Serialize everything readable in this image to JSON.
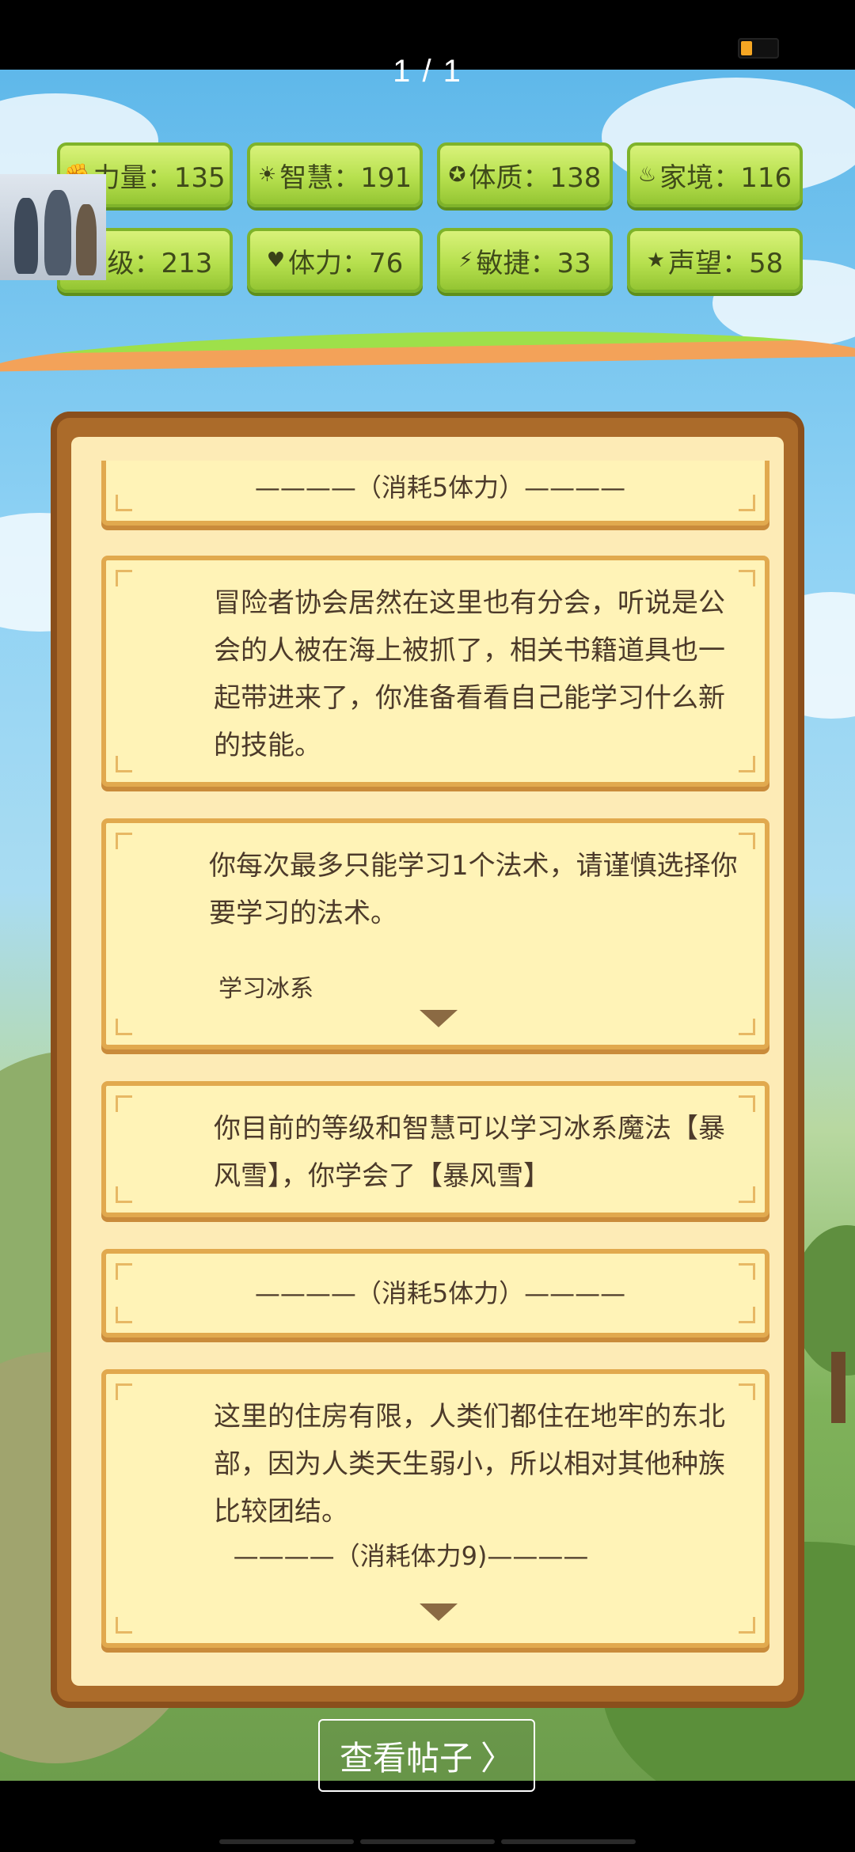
{
  "page_indicator": "1 / 1",
  "stats": [
    {
      "icon": "strength-icon",
      "glyph": "✊",
      "label": "力量：135"
    },
    {
      "icon": "wisdom-icon",
      "glyph": "☀",
      "label": "智慧：191"
    },
    {
      "icon": "constitution-icon",
      "glyph": "✪",
      "label": "体质：138"
    },
    {
      "icon": "family-icon",
      "glyph": "♨",
      "label": "家境：116"
    },
    {
      "icon": "level-icon",
      "glyph": "",
      "label": "等级：213"
    },
    {
      "icon": "stamina-icon",
      "glyph": "♥",
      "label": "体力：76"
    },
    {
      "icon": "agility-icon",
      "glyph": "⚡",
      "label": "敏捷：33"
    },
    {
      "icon": "reputation-icon",
      "glyph": "★",
      "label": "声望：58"
    }
  ],
  "log": {
    "divider_top": "————（消耗5体力）————",
    "event1": "冒险者协会居然在这里也有分会，听说是公会的人被在海上被抓了，相关书籍道具也一起带进来了，你准备看看自己能学习什么新的技能。",
    "event2": "你每次最多只能学习1个法术，请谨慎选择你要学习的法术。",
    "event2_choice": "学习冰系",
    "event3": "你目前的等级和智慧可以学习冰系魔法【暴风雪】，你学会了【暴风雪】",
    "divider_mid": "————（消耗5体力）————",
    "event4": "这里的住房有限，人类们都住在地牢的东北部，因为人类天生弱小，所以相对其他种族比较团结。",
    "event4_cost": "————（消耗体力9)————"
  },
  "footer": {
    "view_post": "查看帖子",
    "chevron": "〉"
  }
}
